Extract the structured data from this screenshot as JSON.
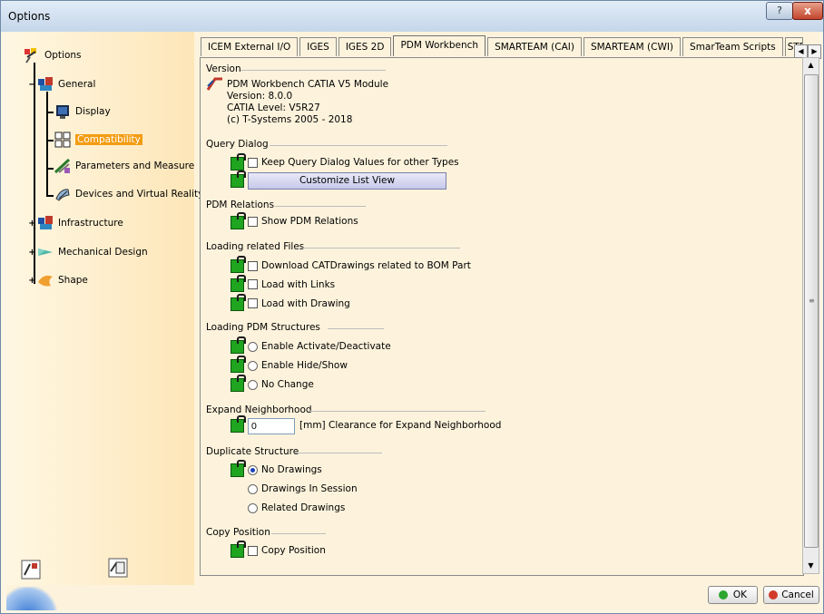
{
  "window": {
    "title": "Options",
    "help_glyph": "?",
    "close_glyph": "x"
  },
  "tree": {
    "root": "Options",
    "items": [
      {
        "label": "General",
        "icon": "general-icon"
      },
      {
        "label": "Display",
        "icon": "display-icon"
      },
      {
        "label": "Compatibility",
        "icon": "compatibility-icon",
        "selected": true
      },
      {
        "label": "Parameters and Measure",
        "icon": "parameters-icon"
      },
      {
        "label": "Devices and Virtual Reality",
        "icon": "devices-icon"
      },
      {
        "label": "Infrastructure",
        "icon": "infrastructure-icon"
      },
      {
        "label": "Mechanical Design",
        "icon": "mechanical-icon"
      },
      {
        "label": "Shape",
        "icon": "shape-icon"
      }
    ]
  },
  "tabs": [
    "ICEM External I/O",
    "IGES",
    "IGES 2D",
    "PDM Workbench",
    "SMARTEAM (CAI)",
    "SMARTEAM (CWI)",
    "SmarTeam Scripts",
    "STE"
  ],
  "active_tab": "PDM Workbench",
  "version": {
    "heading": "Version",
    "module": "PDM Workbench CATIA V5 Module",
    "version": "Version: 8.0.0",
    "level": "CATIA Level: V5R27",
    "copyright": "(c) T-Systems 2005 - 2018"
  },
  "query_dialog": {
    "heading": "Query Dialog",
    "keep_label": "Keep Query Dialog Values for other Types",
    "customize_label": "Customize List View"
  },
  "pdm_relations": {
    "heading": "PDM Relations",
    "show_label": "Show PDM Relations"
  },
  "loading_files": {
    "heading": "Loading related Files",
    "download_label": "Download CATDrawings related to BOM Part",
    "links_label": "Load with Links",
    "drawing_label": "Load with Drawing"
  },
  "loading_structures": {
    "heading": "Loading PDM Structures",
    "activate_label": "Enable Activate/Deactivate",
    "hide_label": "Enable Hide/Show",
    "nochange_label": "No Change"
  },
  "expand": {
    "heading": "Expand Neighborhood",
    "value": "0",
    "unit_label": "[mm]  Clearance for Expand Neighborhood"
  },
  "duplicate": {
    "heading": "Duplicate Structure",
    "no_drawings": "No Drawings",
    "in_session": "Drawings In Session",
    "related": "Related Drawings"
  },
  "copy_position": {
    "heading": "Copy Position",
    "copy_label": "Copy Position"
  },
  "footer": {
    "ok_label": "OK",
    "cancel_label": "Cancel"
  },
  "colors": {
    "accent": "#f39c12",
    "lock_green": "#1fa51f",
    "ok_green": "#2ea52e",
    "cancel_red": "#d23a2a"
  }
}
